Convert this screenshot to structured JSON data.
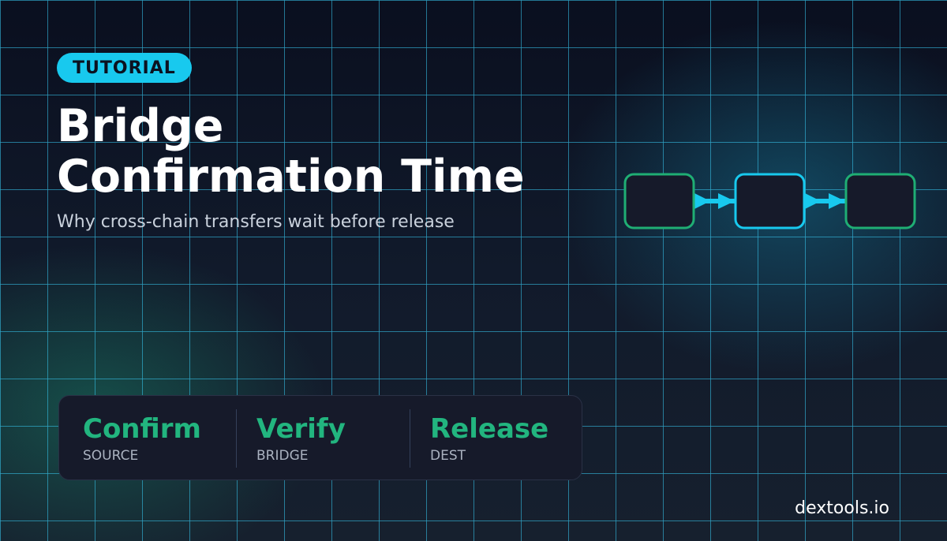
{
  "badge": "TUTORIAL",
  "title": {
    "line1": "Bridge",
    "line2": "Confirmation Time"
  },
  "subtitle": "Why cross-chain transfers wait before release",
  "stats": [
    {
      "value": "Confirm",
      "label": "SOURCE"
    },
    {
      "value": "Verify",
      "label": "BRIDGE"
    },
    {
      "value": "Release",
      "label": "DEST"
    }
  ],
  "brand": "dextools.io",
  "colors": {
    "accent": "#18c9ee",
    "green": "#22b57f",
    "grid": "#38c8f0",
    "card": "#161a2a"
  }
}
